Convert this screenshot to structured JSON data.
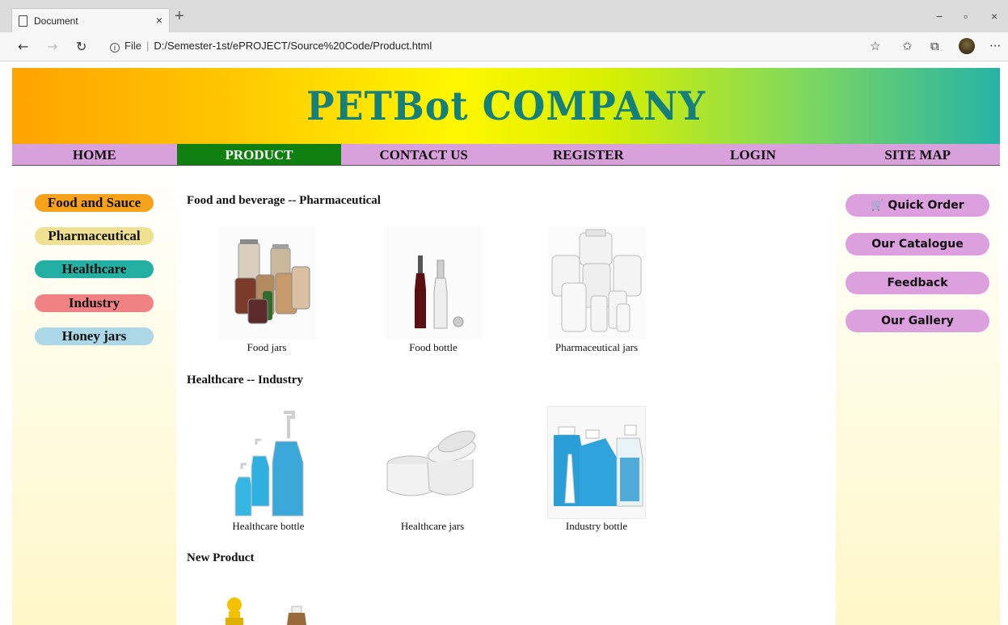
{
  "browser": {
    "tab_title": "Document",
    "tab_close": "×",
    "new_tab": "+",
    "window_controls": [
      "−",
      "▫",
      "×"
    ],
    "nav_buttons": [
      "←",
      "→",
      "↻"
    ],
    "url_file_label": "File",
    "url_separator": "|",
    "url": "D:/Semester-1st/ePROJECT/Source%20Code/Product.html",
    "toolbar_icons": [
      "☆",
      "✩",
      "⧉",
      "···"
    ]
  },
  "banner": {
    "title": "PETBot COMPANY"
  },
  "nav": {
    "items": [
      "HOME",
      "PRODUCT",
      "CONTACT US",
      "REGISTER",
      "LOGIN",
      "SITE MAP"
    ],
    "active": "PRODUCT"
  },
  "left_menu": {
    "items": [
      {
        "label": "Food and Sauce",
        "color": "#f7a21b"
      },
      {
        "label": "Pharmaceutical",
        "color": "#efe092"
      },
      {
        "label": "Healthcare",
        "color": "#23b0a3"
      },
      {
        "label": "Industry",
        "color": "#f08283"
      },
      {
        "label": "Honey jars",
        "color": "#acd7e6"
      }
    ]
  },
  "right_menu": {
    "items": [
      "Quick Order",
      "Our Catalogue",
      "Feedback",
      "Our Gallery"
    ],
    "cart_icon": "🛒"
  },
  "sections": [
    {
      "title": "Food and beverage -- Pharmaceutical",
      "products": [
        "Food jars",
        "Food bottle",
        "Pharmaceutical jars"
      ]
    },
    {
      "title": "Healthcare -- Industry",
      "products": [
        "Healthcare bottle",
        "Healthcare jars",
        "Industry bottle"
      ]
    },
    {
      "title": "New Product",
      "products": []
    }
  ]
}
